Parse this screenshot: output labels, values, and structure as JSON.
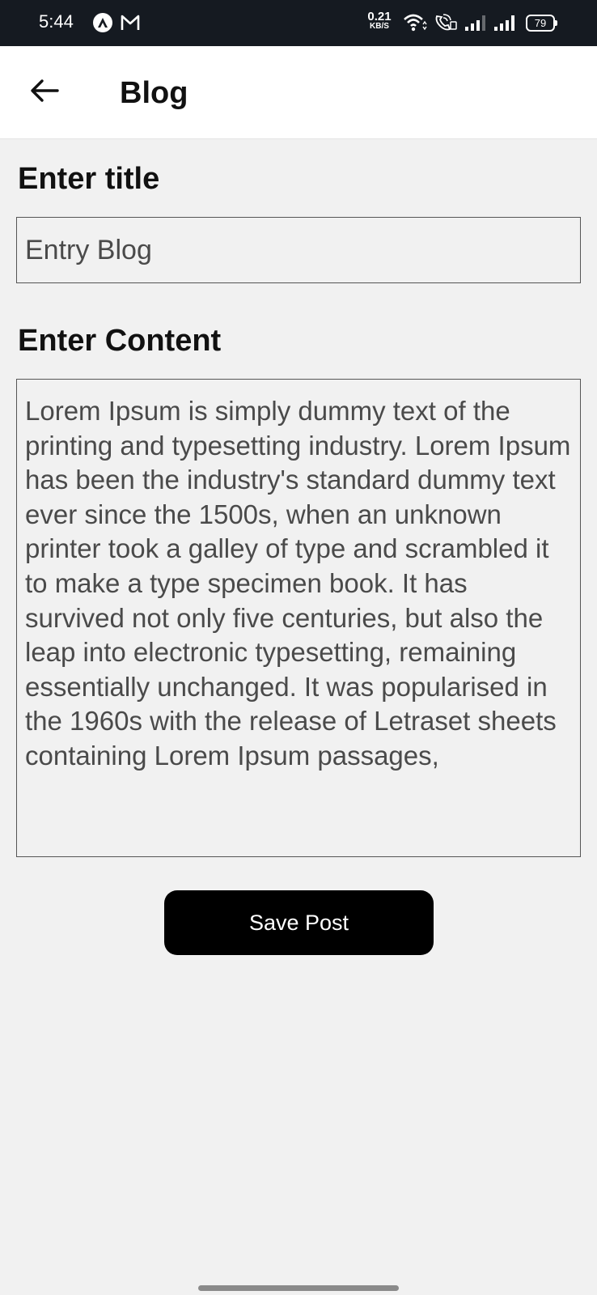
{
  "status_bar": {
    "time": "5:44",
    "net_speed_value": "0.21",
    "net_speed_unit": "KB/S",
    "battery": "79",
    "icons": [
      "app-notification-icon",
      "gmail-icon",
      "wifi-icon",
      "wifi-call-icon",
      "signal-icon",
      "signal-icon"
    ]
  },
  "app_bar": {
    "title": "Blog",
    "back_icon": "arrow-left-icon"
  },
  "form": {
    "title_label": "Enter title",
    "title_value": "Entry Blog",
    "content_label": "Enter Content",
    "content_value": "Lorem Ipsum is simply dummy text of the printing and typesetting industry. Lorem Ipsum has been the industry's standard dummy text ever since the 1500s, when an unknown printer took a galley of type and scrambled it to make a type specimen book. It has survived not only five centuries, but also the leap into electronic typesetting, remaining essentially unchanged. It was popularised in the 1960s with the release of Letraset sheets containing Lorem Ipsum passages,",
    "save_label": "Save Post"
  },
  "colors": {
    "status_bar_bg": "#151a21",
    "app_bar_bg": "#ffffff",
    "page_bg": "#f1f1f1",
    "button_bg": "#000000",
    "button_text": "#ffffff"
  }
}
